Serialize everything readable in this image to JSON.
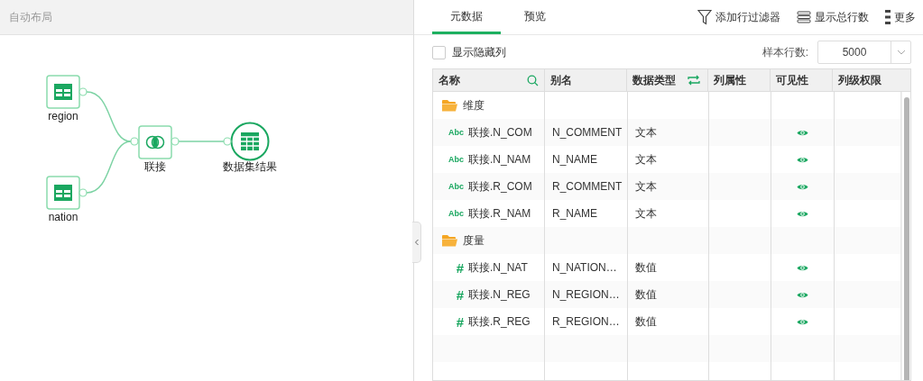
{
  "left_panel": {
    "title": "自动布局",
    "nodes": [
      {
        "kind": "table",
        "label": "region"
      },
      {
        "kind": "table",
        "label": "nation"
      },
      {
        "kind": "join",
        "label": "联接"
      },
      {
        "kind": "result",
        "label": "数据集结果"
      }
    ]
  },
  "tabs": [
    {
      "label": "元数据",
      "selected": true
    },
    {
      "label": "预览",
      "selected": false
    }
  ],
  "toolbar": [
    {
      "kind": "filter",
      "label": "添加行过滤器"
    },
    {
      "kind": "rows",
      "label": "显示总行数"
    },
    {
      "kind": "more",
      "label": "更多"
    }
  ],
  "show_hidden_columns": {
    "label": "显示隐藏列",
    "checked": false
  },
  "sample_rows": {
    "label": "样本行数:",
    "value": "5000"
  },
  "table": {
    "columns": [
      "名称",
      "别名",
      "数据类型",
      "列属性",
      "可见性",
      "列级权限"
    ],
    "groups": [
      {
        "name": "维度",
        "children": [
          {
            "kind": "text",
            "badge": "Abc",
            "name": "联接.N_COM",
            "alias": "N_COMMENT",
            "type": "文本",
            "visible": true
          },
          {
            "kind": "text",
            "badge": "Abc",
            "name": "联接.N_NAM",
            "alias": "N_NAME",
            "type": "文本",
            "visible": true
          },
          {
            "kind": "text",
            "badge": "Abc",
            "name": "联接.R_COM",
            "alias": "R_COMMENT",
            "type": "文本",
            "visible": true
          },
          {
            "kind": "text",
            "badge": "Abc",
            "name": "联接.R_NAM",
            "alias": "R_NAME",
            "type": "文本",
            "visible": true
          }
        ]
      },
      {
        "name": "度量",
        "children": [
          {
            "kind": "number",
            "badge": "#",
            "name": "联接.N_NAT",
            "alias": "N_NATION…",
            "type": "数值",
            "visible": true
          },
          {
            "kind": "number",
            "badge": "#",
            "name": "联接.N_REG",
            "alias": "N_REGION…",
            "type": "数值",
            "visible": true
          },
          {
            "kind": "number",
            "badge": "#",
            "name": "联接.R_REG",
            "alias": "R_REGION…",
            "type": "数值",
            "visible": true
          }
        ]
      }
    ]
  }
}
